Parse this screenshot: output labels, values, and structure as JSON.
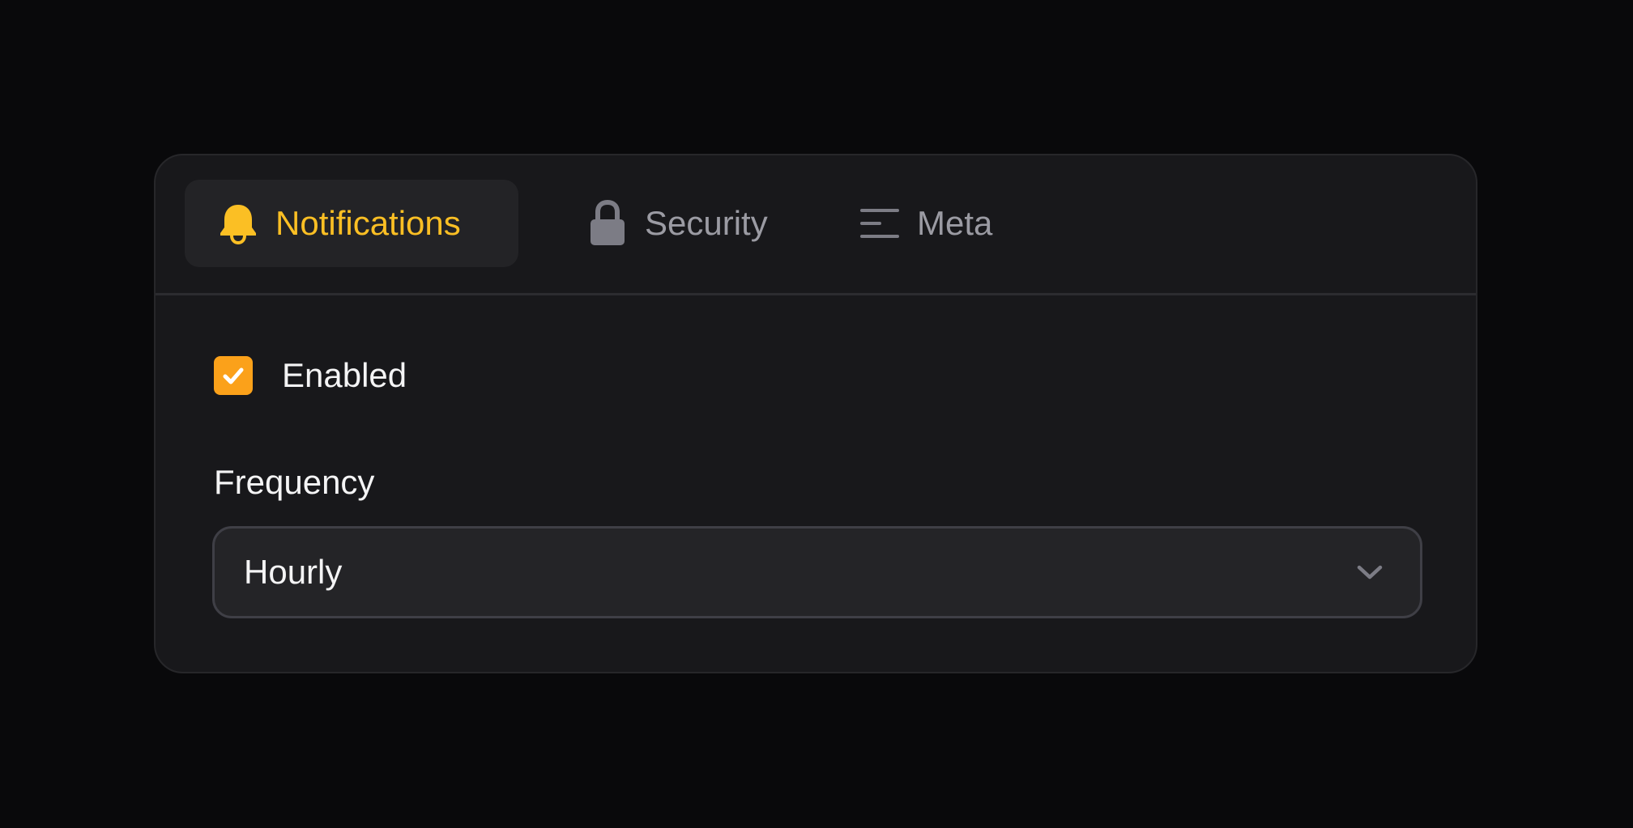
{
  "tabs": [
    {
      "label": "Notifications",
      "icon": "bell-icon",
      "active": true
    },
    {
      "label": "Security",
      "icon": "lock-icon",
      "active": false
    },
    {
      "label": "Meta",
      "icon": "align-left-icon",
      "active": false
    }
  ],
  "notifications": {
    "enabled_label": "Enabled",
    "enabled": true,
    "frequency_label": "Frequency",
    "frequency_value": "Hourly"
  },
  "colors": {
    "accent": "#fbbf24",
    "checkbox": "#fba11a",
    "inactive_icon": "#7c7c85"
  }
}
